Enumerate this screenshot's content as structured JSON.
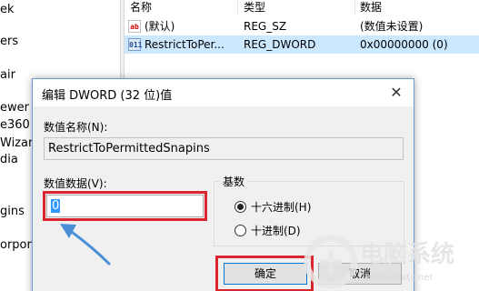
{
  "tree": {
    "items": [
      "ek",
      "ers",
      "air",
      "ewer",
      "e360",
      "Wizard",
      "dia",
      "gins",
      "orpora"
    ]
  },
  "list": {
    "headers": {
      "name": "名称",
      "type": "类型",
      "data": "数据"
    },
    "rows": [
      {
        "icon": "string-value-icon",
        "icon_text": "ab",
        "name": "(默认)",
        "type": "REG_SZ",
        "data": "(数值未设置)"
      },
      {
        "icon": "dword-value-icon",
        "icon_text": "011",
        "name": "RestrictToPer...",
        "type": "REG_DWORD",
        "data": "0x00000000 (0)"
      }
    ]
  },
  "dialog": {
    "title": "编辑 DWORD (32 位)值",
    "close_glyph": "✕",
    "value_name_label": "数值名称(N):",
    "value_name": "RestrictToPermittedSnapins",
    "value_data_label": "数值数据(V):",
    "value_data": "0",
    "base_label": "基数",
    "base_options": [
      {
        "label": "十六进制(H)",
        "checked": true
      },
      {
        "label": "十进制(D)",
        "checked": false
      }
    ],
    "ok_label": "确定",
    "cancel_label": "取消"
  },
  "watermark": {
    "text": "电脑系统",
    "url_fragment": "www.dnxtc.net"
  },
  "colors": {
    "highlight": "#d9262f",
    "arrow": "#4a90d9",
    "selection": "#cce8ff"
  }
}
